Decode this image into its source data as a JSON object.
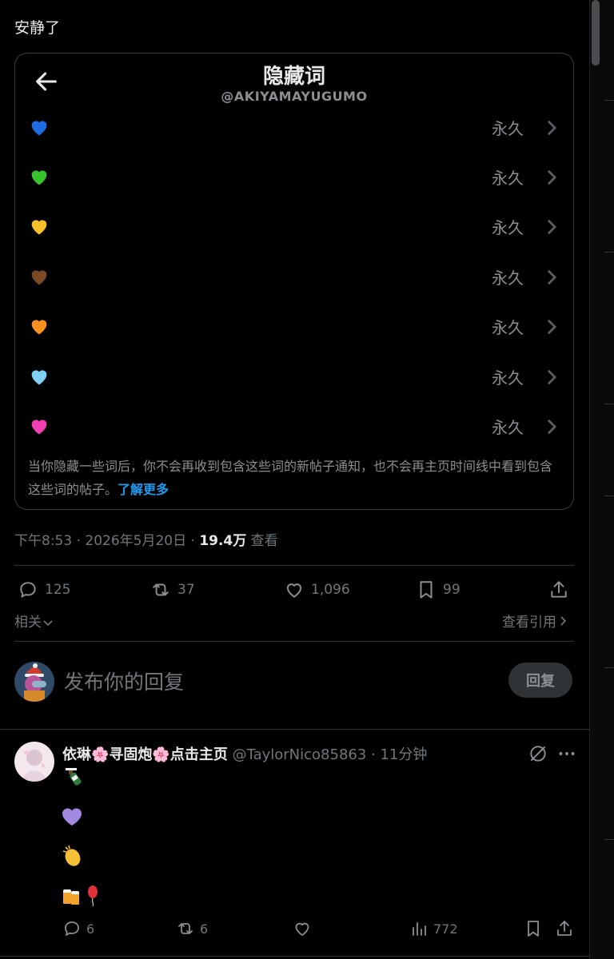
{
  "tweet": {
    "text": "安静了",
    "card": {
      "title": "隐藏词",
      "handle": "@AKIYAMAYUGUMO",
      "rows": [
        {
          "icon": "blue-heart-icon",
          "color": "#1d6de0",
          "duration": "永久"
        },
        {
          "icon": "green-heart-icon",
          "color": "#37c22e",
          "duration": "永久"
        },
        {
          "icon": "yellow-heart-icon",
          "color": "#f6c12a",
          "duration": "永久"
        },
        {
          "icon": "brown-heart-icon",
          "color": "#7a4a26",
          "duration": "永久"
        },
        {
          "icon": "orange-heart-icon",
          "color": "#f7901e",
          "duration": "永久"
        },
        {
          "icon": "light-blue-heart-icon",
          "color": "#7fd0f5",
          "duration": "永久"
        },
        {
          "icon": "pink-heart-icon",
          "color": "#f23fb1",
          "duration": "永久"
        }
      ],
      "note": "当你隐藏一些词后，你不会再收到包含这些词的新帖子通知，也不会再主页时间线中看到包含这些词的帖子。",
      "learn_more": "了解更多"
    },
    "meta": {
      "time_date": "下午8:53 · 2026年5月20日 · ",
      "views": "19.4万",
      "views_label": " 查看"
    },
    "actions": {
      "replies": "125",
      "retweets": "37",
      "likes": "1,096",
      "bookmarks": "99"
    },
    "related": "相关",
    "quotes": "查看引用"
  },
  "reply_box": {
    "placeholder": "发布你的回复",
    "button": "回复"
  },
  "reply": {
    "name": "依琳🌸寻固炮🌸点击主页",
    "handle": "@TaylorNico85863",
    "time": " · 11分钟",
    "actions": {
      "replies": "6",
      "retweets": "6",
      "views": "772"
    }
  },
  "colors": {
    "background": "#000000",
    "text": "#e7e9ea",
    "muted": "#71767b",
    "link": "#1d9bf0"
  }
}
